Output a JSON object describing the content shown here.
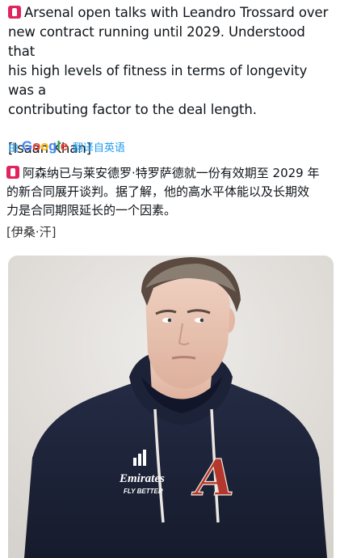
{
  "tweet": {
    "text_lines": [
      "Arsenal open talks with Leandro Trossard over",
      "new contract running until 2029. Understood that",
      "his high levels of fitness in terms of longevity was a",
      "contributing factor to the deal length."
    ],
    "credit": "[Isaan Khan]"
  },
  "translate_bar": {
    "by_label": "由",
    "provider": "Google",
    "action_label": "翻译自英语"
  },
  "translation": {
    "text_lines": [
      "阿森纳已与莱安德罗·特罗萨德就一份有效期至 2029 年",
      "的新合同展开谈判。据了解，他的高水平体能以及长期效",
      "力是合同期限延长的一个因素。"
    ],
    "credit": "[伊桑·汗]"
  },
  "photo": {
    "shirt_sponsor": "Emirates",
    "shirt_tagline": "FLY BETTER",
    "shirt_crest_letter": "A"
  },
  "colors": {
    "badge": "#e0245e",
    "link": "#1d9bf0",
    "hoodie": "#1c2237",
    "crest": "#b3372d"
  }
}
